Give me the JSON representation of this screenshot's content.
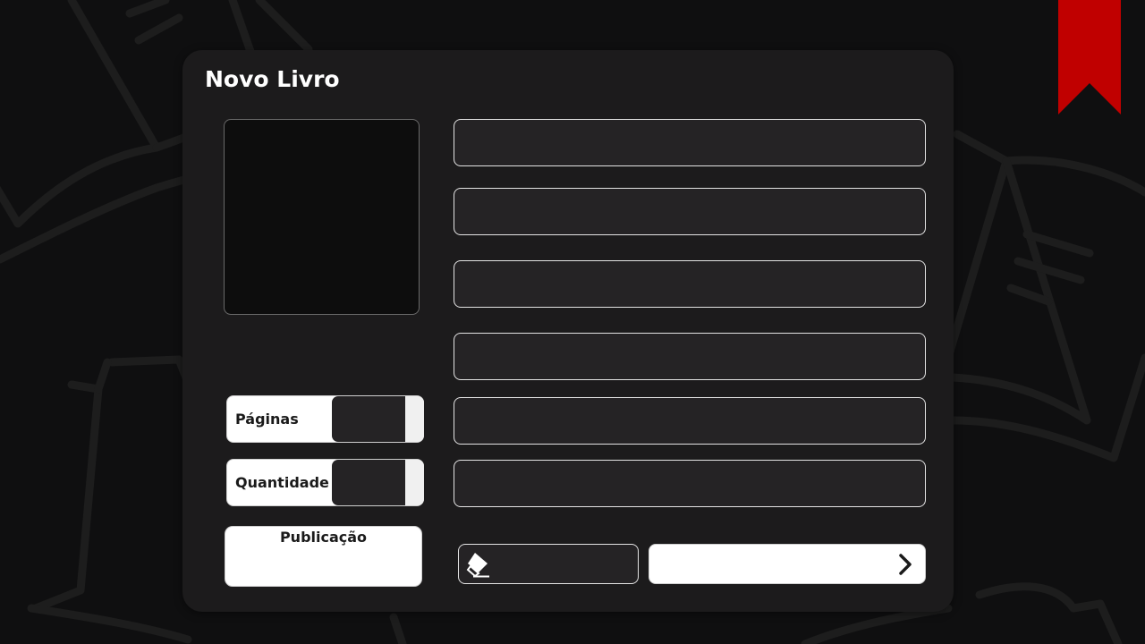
{
  "form": {
    "title": "Novo Livro",
    "fields": [
      {
        "name": "field-1",
        "value": "",
        "placeholder": ""
      },
      {
        "name": "field-2",
        "value": "",
        "placeholder": ""
      },
      {
        "name": "field-3",
        "value": "",
        "placeholder": ""
      },
      {
        "name": "field-4",
        "value": "",
        "placeholder": ""
      },
      {
        "name": "field-5",
        "value": "",
        "placeholder": ""
      },
      {
        "name": "field-6",
        "value": "",
        "placeholder": ""
      }
    ],
    "pages": {
      "label": "Páginas",
      "value": ""
    },
    "quantity": {
      "label": "Quantidade",
      "value": ""
    },
    "publication": {
      "label": "Publicação",
      "value": ""
    },
    "clear_button": {
      "icon": "eraser-icon"
    },
    "next_button": {
      "icon": "chevron-right-icon"
    }
  },
  "colors": {
    "background": "#0f0f10",
    "card": "#1c1b1c",
    "input": "#252325",
    "bookmark": "#c00000"
  }
}
